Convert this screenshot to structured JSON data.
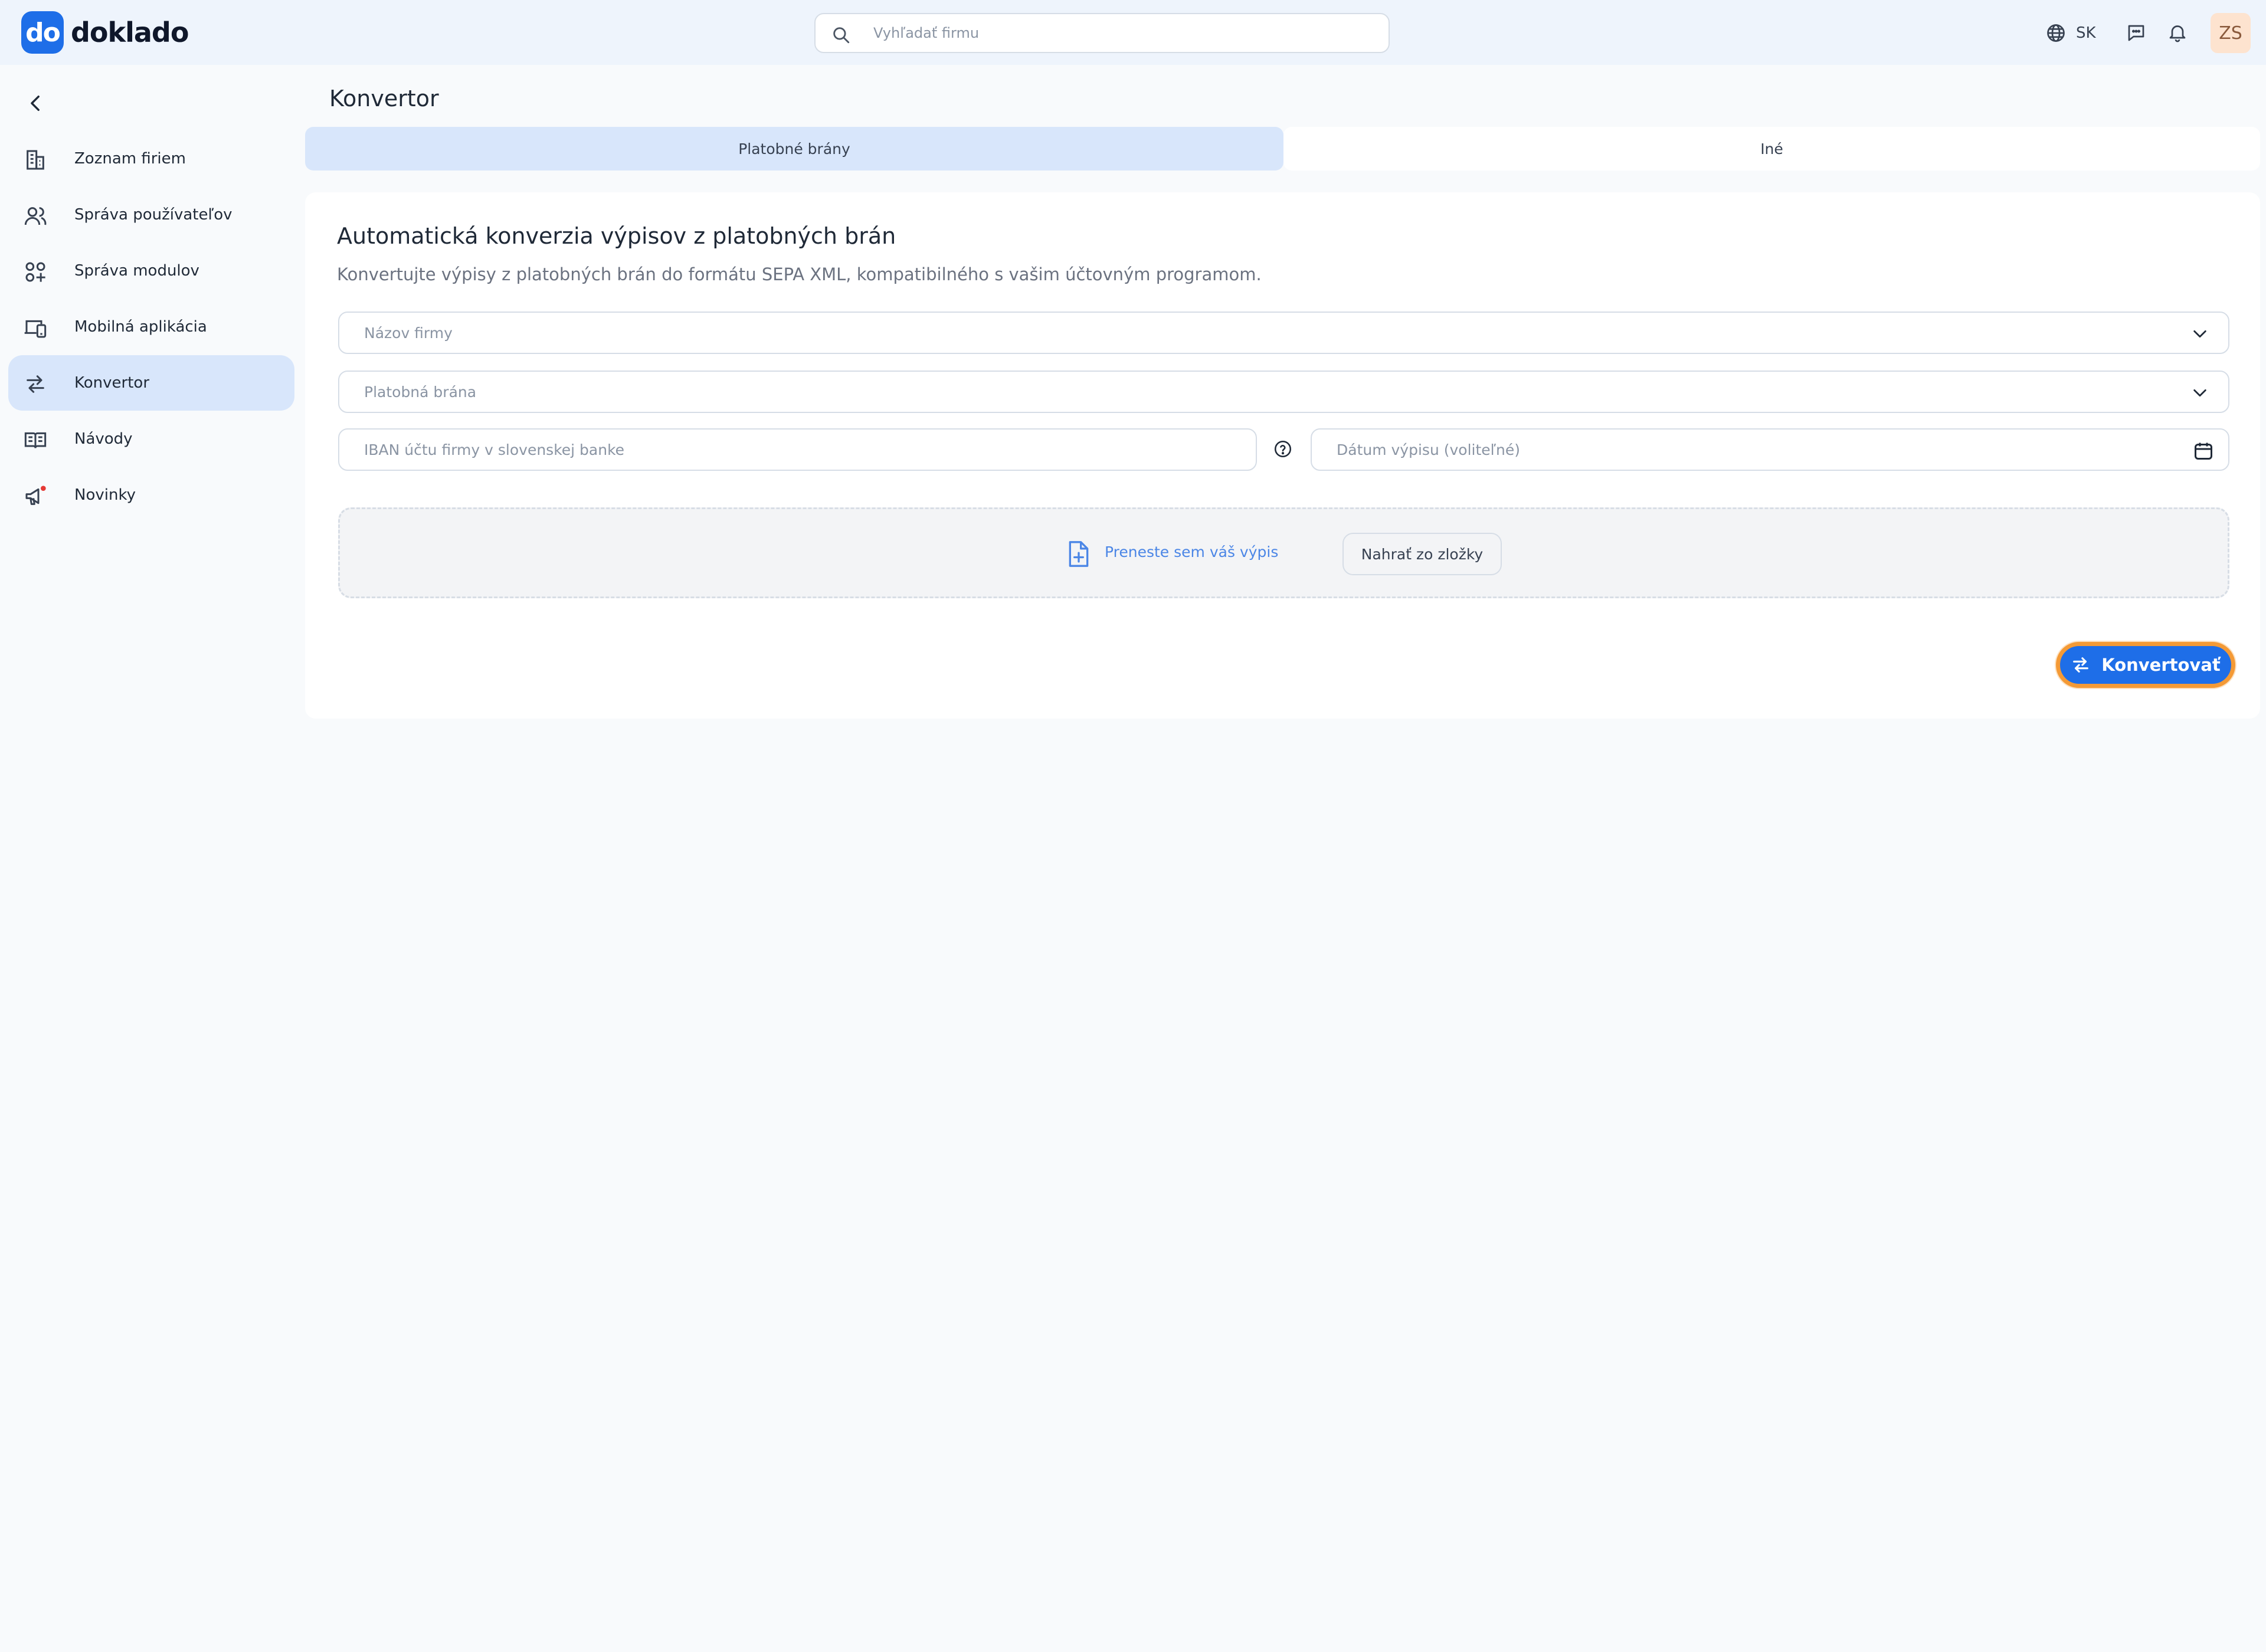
{
  "header": {
    "logo_mark": "do",
    "logo_text": "doklado",
    "search_placeholder": "Vyhľadať firmu",
    "language": "SK",
    "avatar_initials": "ZS"
  },
  "sidebar": {
    "items": [
      {
        "label": "Zoznam firiem",
        "icon": "building-icon",
        "active": false
      },
      {
        "label": "Správa používateľov",
        "icon": "users-icon",
        "active": false
      },
      {
        "label": "Správa modulov",
        "icon": "modules-icon",
        "active": false
      },
      {
        "label": "Mobilná aplikácia",
        "icon": "mobile-devices-icon",
        "active": false
      },
      {
        "label": "Konvertor",
        "icon": "arrows-exchange-icon",
        "active": true
      },
      {
        "label": "Návody",
        "icon": "book-icon",
        "active": false
      },
      {
        "label": "Novinky",
        "icon": "megaphone-icon",
        "active": false
      }
    ]
  },
  "main": {
    "page_title": "Konvertor",
    "tabs": [
      {
        "label": "Platobné brány",
        "active": true
      },
      {
        "label": "Iné",
        "active": false
      }
    ],
    "card": {
      "title": "Automatická konverzia výpisov z platobných brán",
      "subtitle": "Konvertujte výpisy z platobných brán do formátu SEPA XML, kompatibilného s vašim účtovným programom.",
      "company_placeholder": "Názov firmy",
      "gateway_placeholder": "Platobná brána",
      "iban_placeholder": "IBAN účtu firmy v slovenskej banke",
      "date_placeholder": "Dátum výpisu (voliteľné)",
      "drop_label": "Preneste sem váš výpis",
      "upload_button": "Nahrať zo zložky",
      "convert_button": "Konvertovať"
    }
  },
  "colors": {
    "accent": "#1e6ee8",
    "active_bg": "#d8e6fb",
    "focus_ring": "#f49a36"
  }
}
